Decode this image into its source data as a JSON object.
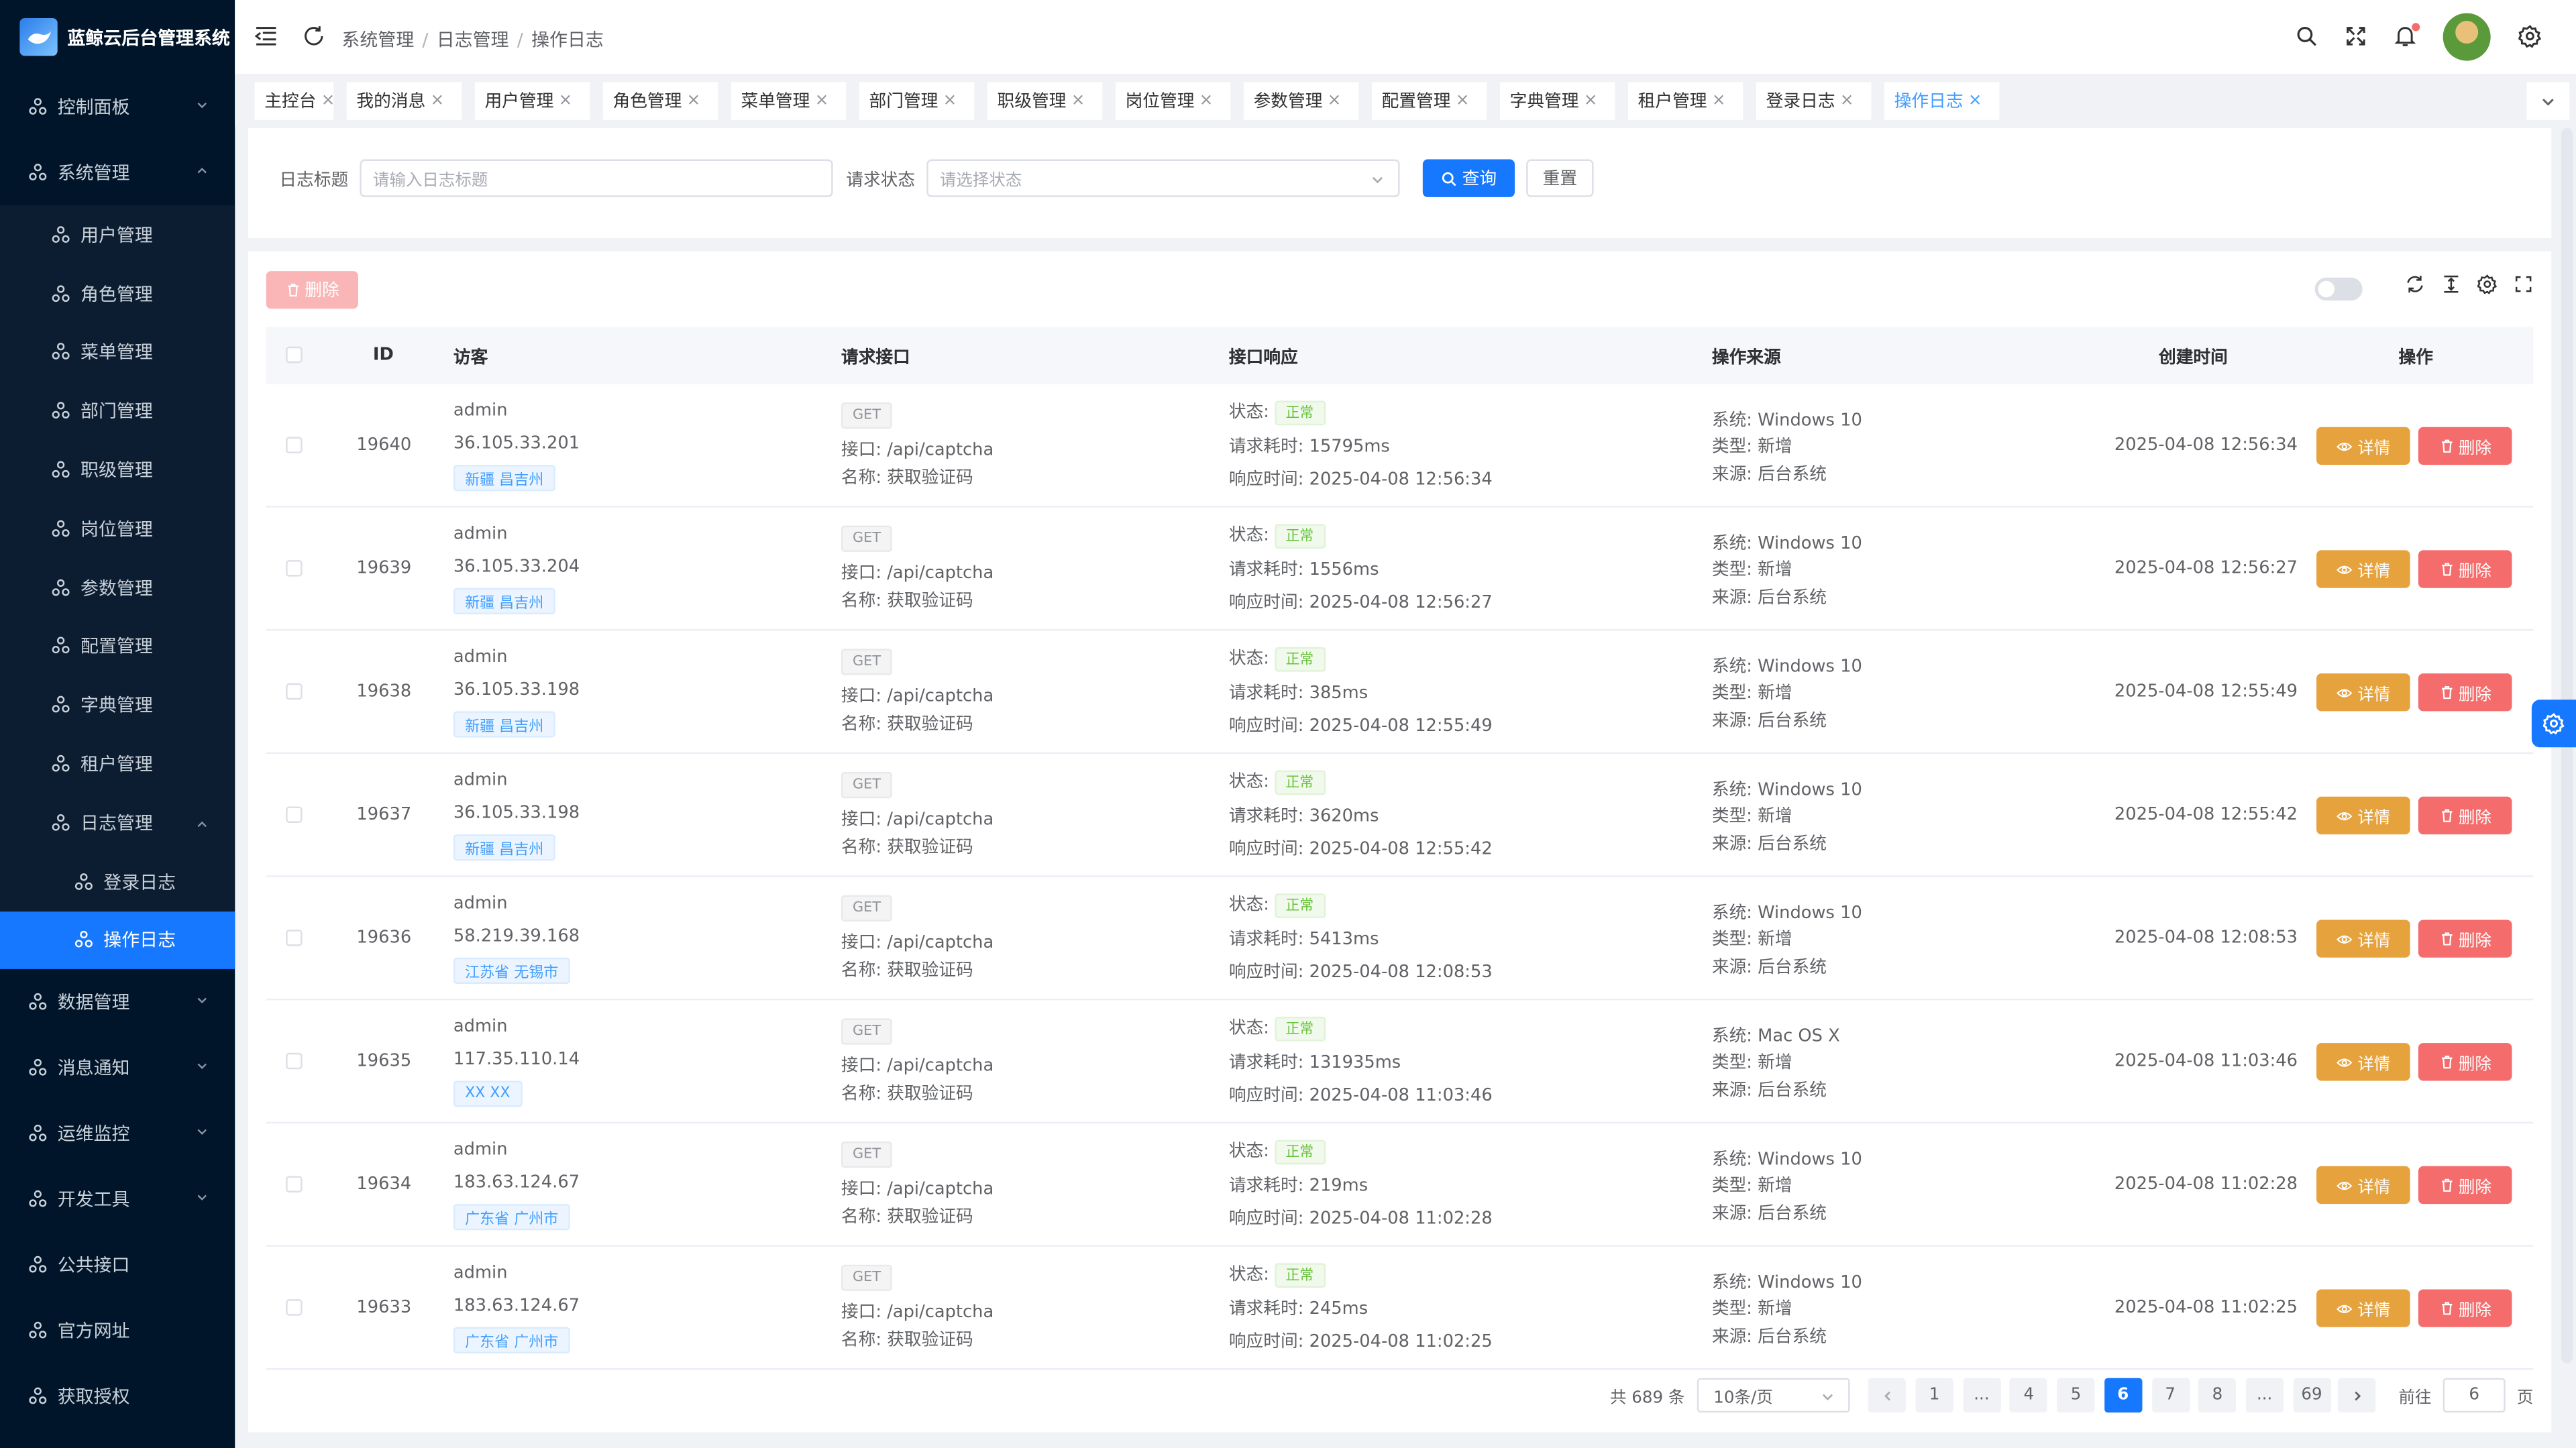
{
  "app": {
    "title": "蓝鲸云后台管理系统"
  },
  "colors": {
    "primary": "#1677ff",
    "sidebar_bg": "#001529",
    "warning": "#e6a23c",
    "danger": "#f56c6c",
    "success": "#67c23a"
  },
  "sidebar": {
    "items": [
      {
        "label": "控制面板",
        "icon": "nodes-icon",
        "expandable": true
      },
      {
        "label": "系统管理",
        "icon": "nodes-icon",
        "expandable": true,
        "expanded": true,
        "children": [
          {
            "label": "用户管理"
          },
          {
            "label": "角色管理"
          },
          {
            "label": "菜单管理"
          },
          {
            "label": "部门管理"
          },
          {
            "label": "职级管理"
          },
          {
            "label": "岗位管理"
          },
          {
            "label": "参数管理"
          },
          {
            "label": "配置管理"
          },
          {
            "label": "字典管理"
          },
          {
            "label": "租户管理"
          },
          {
            "label": "日志管理",
            "expanded": true,
            "children": [
              {
                "label": "登录日志"
              },
              {
                "label": "操作日志",
                "active": true
              }
            ]
          }
        ]
      },
      {
        "label": "数据管理",
        "expandable": true
      },
      {
        "label": "消息通知",
        "expandable": true
      },
      {
        "label": "运维监控",
        "expandable": true
      },
      {
        "label": "开发工具",
        "expandable": true
      },
      {
        "label": "公共接口"
      },
      {
        "label": "官方网址"
      },
      {
        "label": "获取授权"
      }
    ]
  },
  "header": {
    "breadcrumb": [
      "系统管理",
      "日志管理",
      "操作日志"
    ]
  },
  "tabs": [
    {
      "label": "主控台"
    },
    {
      "label": "我的消息"
    },
    {
      "label": "用户管理"
    },
    {
      "label": "角色管理"
    },
    {
      "label": "菜单管理"
    },
    {
      "label": "部门管理"
    },
    {
      "label": "职级管理"
    },
    {
      "label": "岗位管理"
    },
    {
      "label": "参数管理"
    },
    {
      "label": "配置管理"
    },
    {
      "label": "字典管理"
    },
    {
      "label": "租户管理"
    },
    {
      "label": "登录日志"
    },
    {
      "label": "操作日志",
      "active": true
    }
  ],
  "search": {
    "title_label": "日志标题",
    "title_placeholder": "请输入日志标题",
    "status_label": "请求状态",
    "status_placeholder": "请选择状态",
    "query_label": "查询",
    "reset_label": "重置"
  },
  "toolbar": {
    "delete_label": "删除"
  },
  "table": {
    "columns": [
      "ID",
      "访客",
      "请求接口",
      "接口响应",
      "操作来源",
      "创建时间",
      "操作"
    ],
    "labels": {
      "status": "状态:",
      "duration": "请求耗时:",
      "resp_time": "响应时间:",
      "api": "接口:",
      "name": "名称:",
      "system": "系统:",
      "type": "类型:",
      "source": "来源:"
    },
    "detail_label": "详情",
    "delete_label": "删除",
    "rows": [
      {
        "id": "19640",
        "user": "admin",
        "ip": "36.105.33.201",
        "geo": "新疆 昌吉州",
        "method": "GET",
        "api": "/api/captcha",
        "name": "获取验证码",
        "status": "正常",
        "duration": "15795ms",
        "resp_time": "2025-04-08 12:56:34",
        "system": "Windows 10",
        "type": "新增",
        "source": "后台系统",
        "created": "2025-04-08 12:56:34"
      },
      {
        "id": "19639",
        "user": "admin",
        "ip": "36.105.33.204",
        "geo": "新疆 昌吉州",
        "method": "GET",
        "api": "/api/captcha",
        "name": "获取验证码",
        "status": "正常",
        "duration": "1556ms",
        "resp_time": "2025-04-08 12:56:27",
        "system": "Windows 10",
        "type": "新增",
        "source": "后台系统",
        "created": "2025-04-08 12:56:27"
      },
      {
        "id": "19638",
        "user": "admin",
        "ip": "36.105.33.198",
        "geo": "新疆 昌吉州",
        "method": "GET",
        "api": "/api/captcha",
        "name": "获取验证码",
        "status": "正常",
        "duration": "385ms",
        "resp_time": "2025-04-08 12:55:49",
        "system": "Windows 10",
        "type": "新增",
        "source": "后台系统",
        "created": "2025-04-08 12:55:49"
      },
      {
        "id": "19637",
        "user": "admin",
        "ip": "36.105.33.198",
        "geo": "新疆 昌吉州",
        "method": "GET",
        "api": "/api/captcha",
        "name": "获取验证码",
        "status": "正常",
        "duration": "3620ms",
        "resp_time": "2025-04-08 12:55:42",
        "system": "Windows 10",
        "type": "新增",
        "source": "后台系统",
        "created": "2025-04-08 12:55:42"
      },
      {
        "id": "19636",
        "user": "admin",
        "ip": "58.219.39.168",
        "geo": "江苏省 无锡市",
        "method": "GET",
        "api": "/api/captcha",
        "name": "获取验证码",
        "status": "正常",
        "duration": "5413ms",
        "resp_time": "2025-04-08 12:08:53",
        "system": "Windows 10",
        "type": "新增",
        "source": "后台系统",
        "created": "2025-04-08 12:08:53"
      },
      {
        "id": "19635",
        "user": "admin",
        "ip": "117.35.110.14",
        "geo": "XX XX",
        "method": "GET",
        "api": "/api/captcha",
        "name": "获取验证码",
        "status": "正常",
        "duration": "131935ms",
        "resp_time": "2025-04-08 11:03:46",
        "system": "Mac OS X",
        "type": "新增",
        "source": "后台系统",
        "created": "2025-04-08 11:03:46"
      },
      {
        "id": "19634",
        "user": "admin",
        "ip": "183.63.124.67",
        "geo": "广东省 广州市",
        "method": "GET",
        "api": "/api/captcha",
        "name": "获取验证码",
        "status": "正常",
        "duration": "219ms",
        "resp_time": "2025-04-08 11:02:28",
        "system": "Windows 10",
        "type": "新增",
        "source": "后台系统",
        "created": "2025-04-08 11:02:28"
      },
      {
        "id": "19633",
        "user": "admin",
        "ip": "183.63.124.67",
        "geo": "广东省 广州市",
        "method": "GET",
        "api": "/api/captcha",
        "name": "获取验证码",
        "status": "正常",
        "duration": "245ms",
        "resp_time": "2025-04-08 11:02:25",
        "system": "Windows 10",
        "type": "新增",
        "source": "后台系统",
        "created": "2025-04-08 11:02:25"
      }
    ]
  },
  "pagination": {
    "total": "共 689 条",
    "page_size": "10条/页",
    "pages": [
      "1",
      "...",
      "4",
      "5",
      "6",
      "7",
      "8",
      "...",
      "69"
    ],
    "current": "6",
    "goto_label": "前往",
    "goto_value": "6",
    "goto_suffix": "页"
  }
}
